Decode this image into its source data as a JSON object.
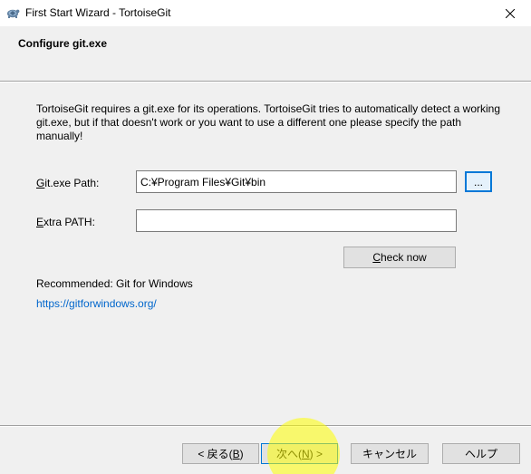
{
  "window": {
    "title": "First Start Wizard - TortoiseGit",
    "icon": "tortoisegit-icon"
  },
  "header": {
    "title": "Configure git.exe"
  },
  "description": "TortoiseGit requires a git.exe for its operations. TortoiseGit tries to automatically detect a working git.exe, but if that doesn't work or you want to use a different one please specify the path manually!",
  "gitexe_path": {
    "label_mnemonic": "G",
    "label_rest": "it.exe Path:",
    "value": "C:¥Program Files¥Git¥bin",
    "browse_label": "..."
  },
  "extra_path": {
    "label_mnemonic": "E",
    "label_rest": "xtra PATH:",
    "value": ""
  },
  "check_now": {
    "label_mnemonic": "C",
    "label_rest": "heck now"
  },
  "recommendation": {
    "label": "Recommended: Git for Windows",
    "link": "https://gitforwindows.org/"
  },
  "footer": {
    "back_prefix": "< 戻る(",
    "back_mnemonic": "B",
    "back_suffix": ")",
    "next_prefix": "次へ(",
    "next_mnemonic": "N",
    "next_suffix": ") >",
    "cancel_label": "キャンセル",
    "help_label": "ヘルプ"
  },
  "colors": {
    "accent": "#0078d7",
    "link": "#0066cc",
    "highlight": "#ffff00"
  }
}
